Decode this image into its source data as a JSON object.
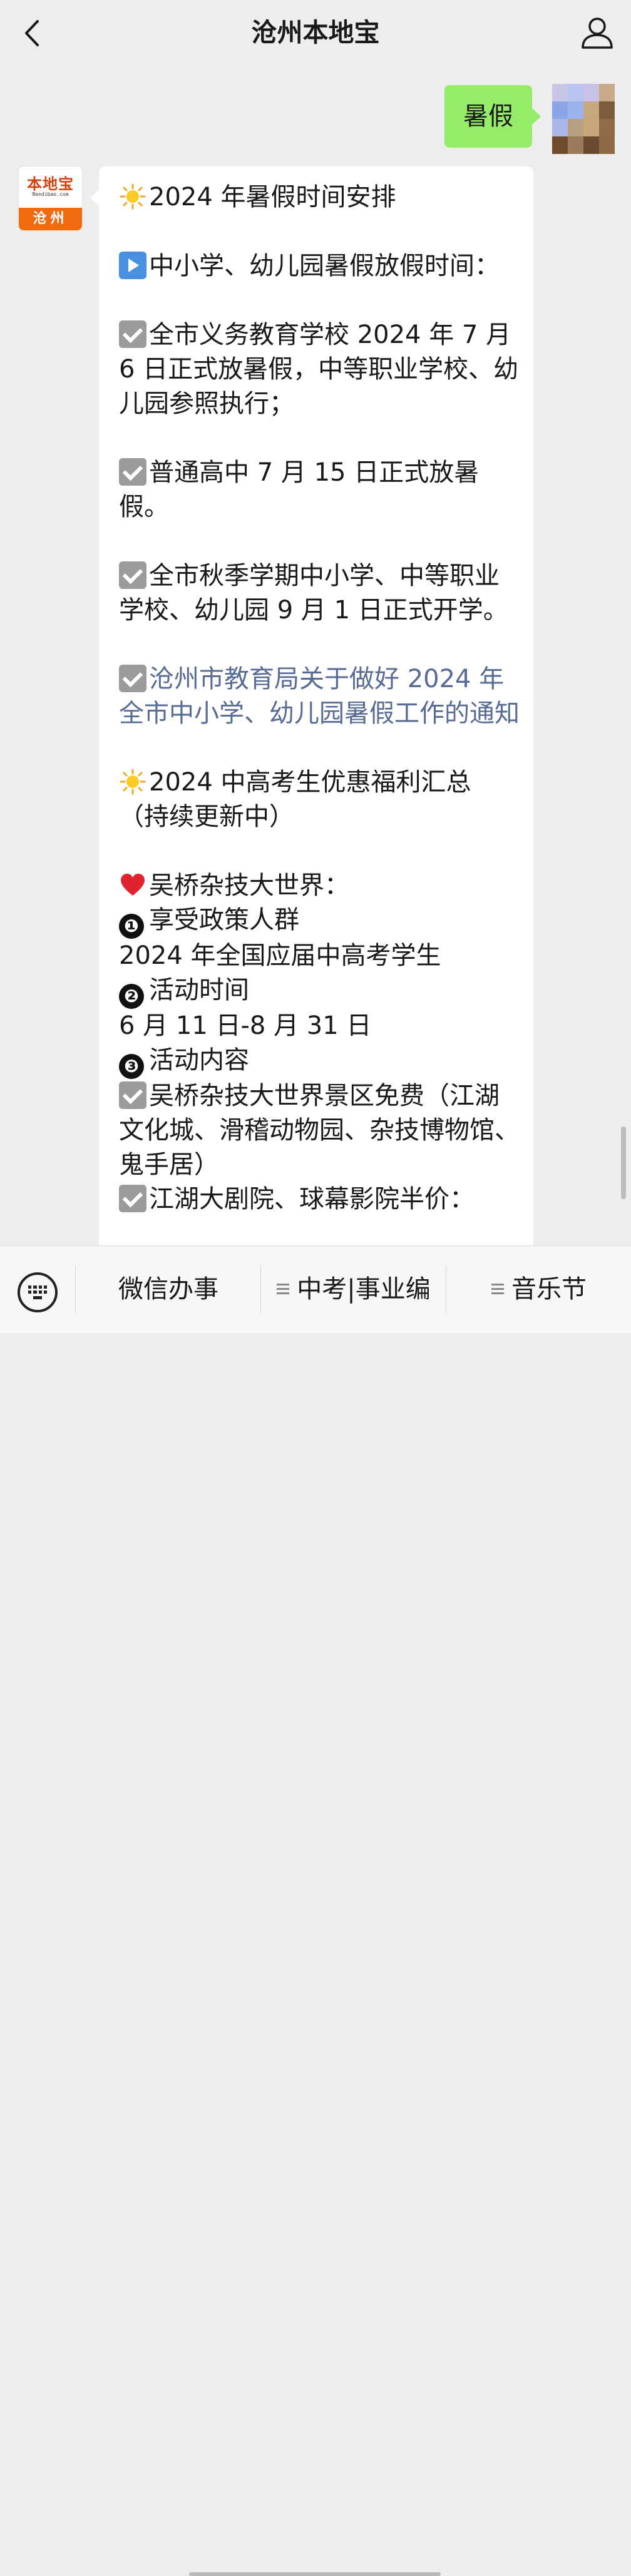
{
  "header": {
    "title": "沧州本地宝",
    "back_icon": "chevron-left-icon",
    "profile_icon": "person-icon"
  },
  "sent_message": {
    "text": "暑假",
    "bubble_color": "#95ec69"
  },
  "account_avatar": {
    "brand": "本地宝",
    "domain": "Bendibao.com",
    "city": "沧州"
  },
  "article": {
    "line1": "2024 年暑假时间安排",
    "line2": "中小学、幼儿园暑假放假时间：",
    "item1": "全市义务教育学校 2024 年 7 月 6 日正式放暑假，中等职业学校、幼儿园参照执行；",
    "item2": "普通高中 7 月 15 日正式放暑假。",
    "item3": "全市秋季学期中小学、中等职业学校、幼儿园 9 月 1 日正式开学。",
    "link1": "沧州市教育局关于做好 2024 年全市中小学、幼儿园暑假工作的通知",
    "section2": "2024 中高考生优惠福利汇总（持续更新中）",
    "venue": "吴桥杂技大世界：",
    "n1": "❶",
    "n1_label": "享受政策人群",
    "n1_value": "2024 年全国应届中高考学生",
    "n2": "❷",
    "n2_label": "活动时间",
    "n2_value": "6 月 11 日-8 月 31 日",
    "n3": "❸",
    "n3_label": "活动内容",
    "benefit1": "吴桥杂技大世界景区免费（江湖文化城、滑稽动物园、杂技博物馆、鬼手居）",
    "benefit2_partial": "江湖大剧院、球幕影院半价：",
    "link_color": "#576b95"
  },
  "bottom_menu": {
    "keyboard_icon": "keyboard-icon",
    "item1": "微信办事",
    "item2": "中考|事业编",
    "item3": "音乐节"
  }
}
